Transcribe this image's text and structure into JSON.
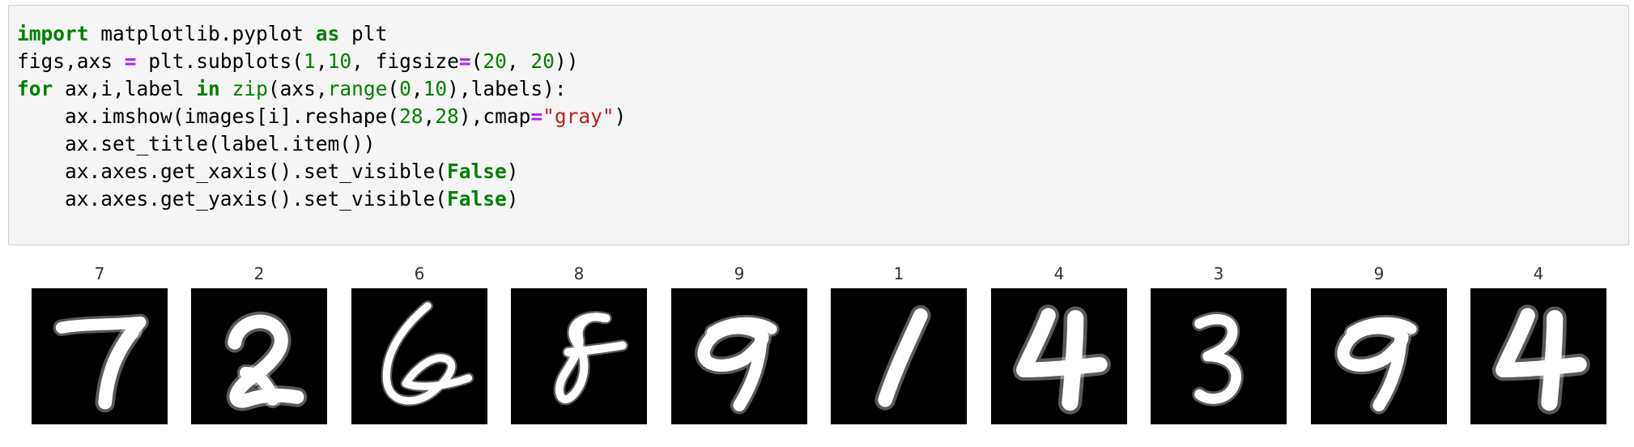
{
  "code_cell": {
    "lines": [
      [
        {
          "t": "import",
          "c": "kw"
        },
        {
          "t": " matplotlib.pyplot "
        },
        {
          "t": "as",
          "c": "kw"
        },
        {
          "t": " plt"
        }
      ],
      [
        {
          "t": "figs,axs "
        },
        {
          "t": "=",
          "c": "op"
        },
        {
          "t": " plt.subplots("
        },
        {
          "t": "1",
          "c": "num"
        },
        {
          "t": ","
        },
        {
          "t": "10",
          "c": "num"
        },
        {
          "t": ", figsize"
        },
        {
          "t": "=",
          "c": "op"
        },
        {
          "t": "("
        },
        {
          "t": "20",
          "c": "num"
        },
        {
          "t": ", "
        },
        {
          "t": "20",
          "c": "num"
        },
        {
          "t": "))"
        }
      ],
      [
        {
          "t": "for",
          "c": "kw"
        },
        {
          "t": " ax,i,label "
        },
        {
          "t": "in",
          "c": "kw"
        },
        {
          "t": " "
        },
        {
          "t": "zip",
          "c": "bi"
        },
        {
          "t": "(axs,"
        },
        {
          "t": "range",
          "c": "bi"
        },
        {
          "t": "("
        },
        {
          "t": "0",
          "c": "num"
        },
        {
          "t": ","
        },
        {
          "t": "10",
          "c": "num"
        },
        {
          "t": "),labels):"
        }
      ],
      [
        {
          "t": "    ax.imshow(images[i].reshape("
        },
        {
          "t": "28",
          "c": "num"
        },
        {
          "t": ","
        },
        {
          "t": "28",
          "c": "num"
        },
        {
          "t": "),cmap"
        },
        {
          "t": "=",
          "c": "op"
        },
        {
          "t": "\"gray\"",
          "c": "str"
        },
        {
          "t": ")"
        }
      ],
      [
        {
          "t": "    ax.set_title(label.item())"
        }
      ],
      [
        {
          "t": "    ax.axes.get_xaxis().set_visible("
        },
        {
          "t": "False",
          "c": "kc"
        },
        {
          "t": ")"
        }
      ],
      [
        {
          "t": "    ax.axes.get_yaxis().set_visible("
        },
        {
          "t": "False",
          "c": "kc"
        },
        {
          "t": ")"
        }
      ]
    ]
  },
  "output": {
    "colormap": "gray",
    "background_color": "#000000",
    "stroke_color": "#ffffff",
    "panels": [
      {
        "label": "7",
        "digit": "7"
      },
      {
        "label": "2",
        "digit": "2"
      },
      {
        "label": "6",
        "digit": "6"
      },
      {
        "label": "8",
        "digit": "8"
      },
      {
        "label": "9",
        "digit": "9"
      },
      {
        "label": "1",
        "digit": "1"
      },
      {
        "label": "4",
        "digit": "4"
      },
      {
        "label": "3",
        "digit": "3"
      },
      {
        "label": "9",
        "digit": "9"
      },
      {
        "label": "4",
        "digit": "4"
      }
    ]
  }
}
